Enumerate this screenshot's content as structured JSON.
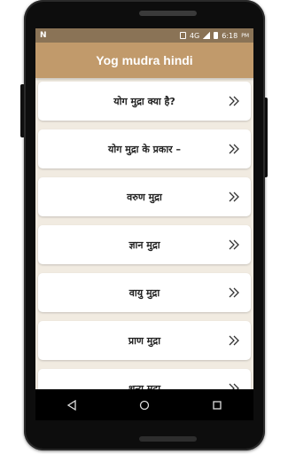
{
  "status_bar": {
    "left_icon": "N",
    "network": "4G",
    "time": "6:18",
    "ampm": "PM"
  },
  "app_bar": {
    "title": "Yog mudra hindi"
  },
  "items": [
    {
      "label": "योग मुद्रा क्या है?",
      "icon": "double-chevron-right"
    },
    {
      "label": "योग मुद्रा के प्रकार –",
      "icon": "double-chevron-right"
    },
    {
      "label": "वरुण मुद्रा",
      "icon": "double-chevron-right"
    },
    {
      "label": "ज्ञान मुद्रा",
      "icon": "double-chevron-right"
    },
    {
      "label": "वायु मुद्रा",
      "icon": "double-chevron-right"
    },
    {
      "label": "प्राण मुद्रा",
      "icon": "double-chevron-right"
    },
    {
      "label": "शून्य मुद्रा",
      "icon": "double-chevron-right"
    }
  ],
  "nav": {
    "back": "back-icon",
    "home": "home-icon",
    "recents": "recents-icon"
  },
  "colors": {
    "status_bar": "#8a7356",
    "app_bar": "#c19a6b",
    "background": "#f1ebe1",
    "card": "#ffffff"
  }
}
